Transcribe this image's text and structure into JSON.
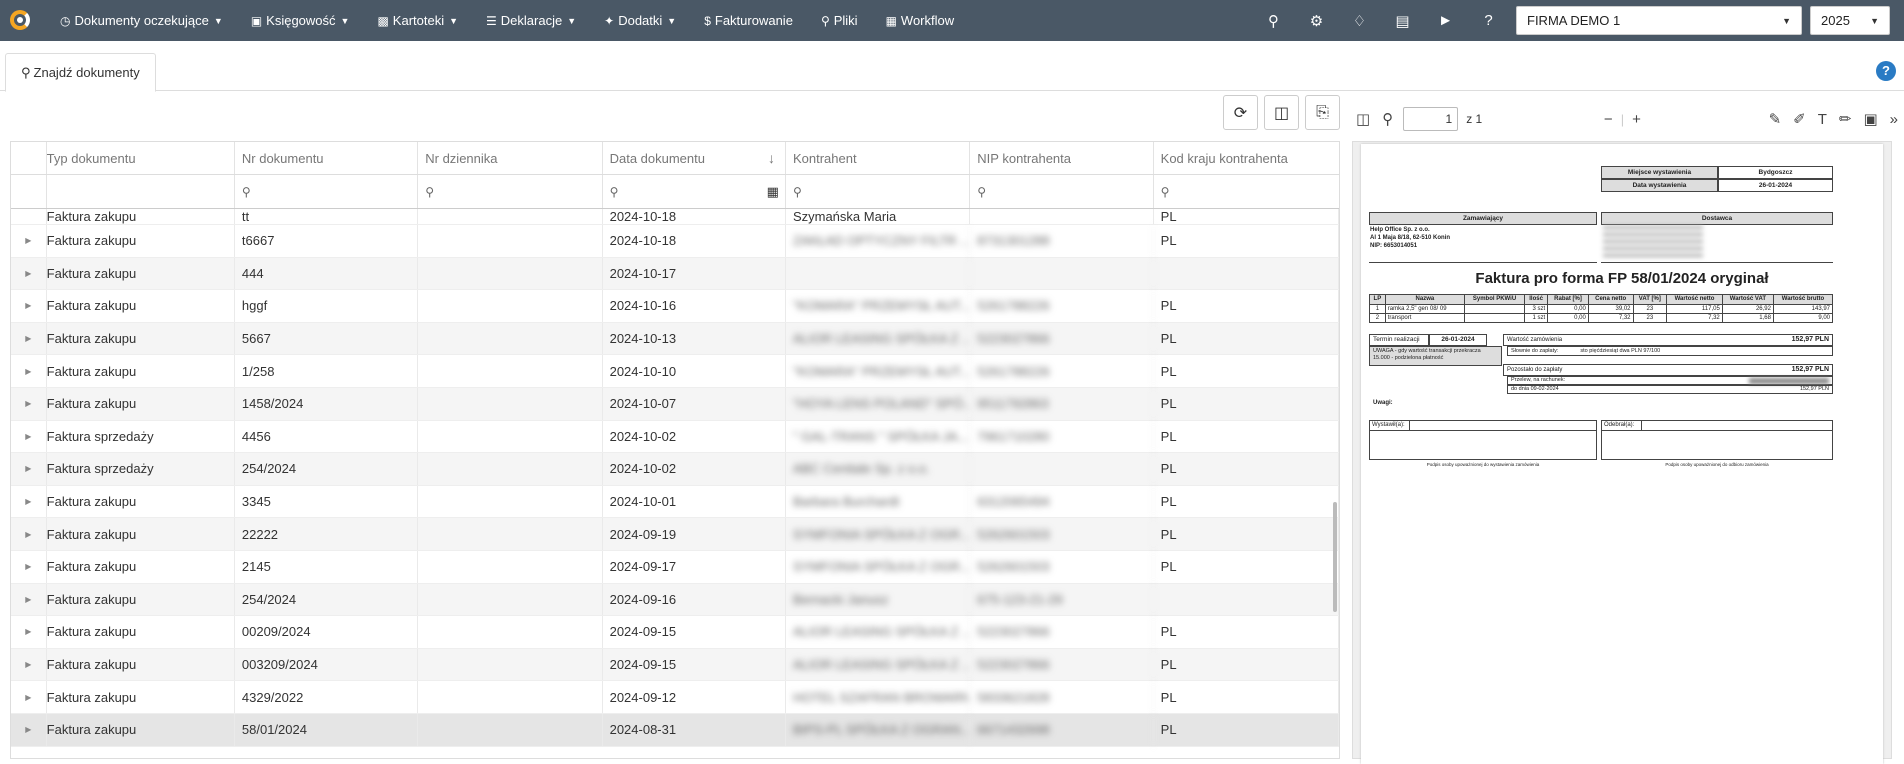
{
  "nav": {
    "items": [
      {
        "label": "Dokumenty oczekujące",
        "icon": "clock-icon",
        "caret": true
      },
      {
        "label": "Księgowość",
        "icon": "book-icon",
        "caret": true
      },
      {
        "label": "Kartoteki",
        "icon": "briefcase-icon",
        "caret": true
      },
      {
        "label": "Deklaracje",
        "icon": "list-icon",
        "caret": true
      },
      {
        "label": "Dodatki",
        "icon": "magic-icon",
        "caret": true
      },
      {
        "label": "Fakturowanie",
        "icon": "dollar-icon",
        "caret": false
      },
      {
        "label": "Pliki",
        "icon": "search-icon",
        "caret": false
      },
      {
        "label": "Workflow",
        "icon": "sitemap-icon",
        "caret": false
      }
    ],
    "company": "FIRMA DEMO 1",
    "year": "2025"
  },
  "tab": {
    "label": "Znajdź dokumenty"
  },
  "grid": {
    "columns": [
      "Typ dokumentu",
      "Nr dokumentu",
      "Nr dziennika",
      "Data dokumentu",
      "Kontrahent",
      "NIP kontrahenta",
      "Kod kraju kontrahenta"
    ],
    "top_partial": {
      "type": "Faktura zakupu",
      "number": "tt",
      "date": "2024-10-18",
      "contractor": "Szymańska Maria",
      "nip": "",
      "country": "PL"
    },
    "rows": [
      {
        "type": "Faktura zakupu",
        "number": "t6667",
        "journal": "",
        "date": "2024-10-18",
        "contractor": "ZAKŁAD OPTYCZNY FILTR ...",
        "nip": "8731301288",
        "country": "PL"
      },
      {
        "type": "Faktura zakupu",
        "number": "444",
        "journal": "",
        "date": "2024-10-17",
        "contractor": "",
        "nip": "",
        "country": ""
      },
      {
        "type": "Faktura zakupu",
        "number": "hggf",
        "journal": "",
        "date": "2024-10-16",
        "contractor": "\"KOMARA\" PRZEMYSŁ AUT...",
        "nip": "5261788226",
        "country": "PL"
      },
      {
        "type": "Faktura zakupu",
        "number": "5667",
        "journal": "",
        "date": "2024-10-13",
        "contractor": "ALIOR LEASING SPÓŁKA Z ...",
        "nip": "5223027866",
        "country": "PL"
      },
      {
        "type": "Faktura zakupu",
        "number": "1/258",
        "journal": "",
        "date": "2024-10-10",
        "contractor": "\"KOMARA\" PRZEMYSŁ AUT...",
        "nip": "5261788226",
        "country": "PL"
      },
      {
        "type": "Faktura zakupu",
        "number": "1458/2024",
        "journal": "",
        "date": "2024-10-07",
        "contractor": "\"HOYA LENS POLAND\" SPÓ...",
        "nip": "9511792863",
        "country": "PL"
      },
      {
        "type": "Faktura sprzedaży",
        "number": "4456",
        "journal": "",
        "date": "2024-10-02",
        "contractor": "\" GAL-TRANS \" SPÓŁKA JA...",
        "nip": "7961710280",
        "country": "PL"
      },
      {
        "type": "Faktura sprzedaży",
        "number": "254/2024",
        "journal": "",
        "date": "2024-10-02",
        "contractor": "ABC Cenitale Sp. z o.o.",
        "nip": "",
        "country": "PL"
      },
      {
        "type": "Faktura zakupu",
        "number": "3345",
        "journal": "",
        "date": "2024-10-01",
        "contractor": "Barbara Burchardt",
        "nip": "6312065494",
        "country": "PL"
      },
      {
        "type": "Faktura zakupu",
        "number": "22222",
        "journal": "",
        "date": "2024-09-19",
        "contractor": "SYMFONIA SPÓŁKA Z OGR...",
        "nip": "5262601503",
        "country": "PL"
      },
      {
        "type": "Faktura zakupu",
        "number": "2145",
        "journal": "",
        "date": "2024-09-17",
        "contractor": "SYMFONIA SPÓŁKA Z OGR...",
        "nip": "5262601503",
        "country": "PL"
      },
      {
        "type": "Faktura zakupu",
        "number": "254/2024",
        "journal": "",
        "date": "2024-09-16",
        "contractor": "Bernacki Janusz",
        "nip": "675-123-21-29",
        "country": ""
      },
      {
        "type": "Faktura zakupu",
        "number": "00209/2024",
        "journal": "",
        "date": "2024-09-15",
        "contractor": "ALIOR LEASING SPÓŁKA Z ...",
        "nip": "5223027866",
        "country": "PL"
      },
      {
        "type": "Faktura zakupu",
        "number": "003209/2024",
        "journal": "",
        "date": "2024-09-15",
        "contractor": "ALIOR LEASING SPÓŁKA Z ...",
        "nip": "5223027866",
        "country": "PL"
      },
      {
        "type": "Faktura zakupu",
        "number": "4329/2022",
        "journal": "",
        "date": "2024-09-12",
        "contractor": "HOTEL SZAFRAN BROWARN...",
        "nip": "5833621828",
        "country": "PL"
      },
      {
        "type": "Faktura zakupu",
        "number": "58/01/2024",
        "journal": "",
        "date": "2024-08-31",
        "contractor": "BIPS-PL SPÓŁKA Z OGRAN...",
        "nip": "6671432698",
        "country": "PL"
      }
    ]
  },
  "viewer": {
    "page": "1",
    "of_label": "z 1"
  },
  "pdf": {
    "place_label": "Miejsce wystawienia",
    "place_value": "Bydgoszcz",
    "date_label": "Data wystawienia",
    "date_value": "26-01-2024",
    "ordering_label": "Zamawiający",
    "supplier_label": "Dostawca",
    "ordering_name": "Help Office Sp. z o.o.",
    "ordering_addr": "Al 1 Maja 8/18, 62-510 Konin",
    "ordering_nip": "NIP: 6653014051",
    "title": "Faktura pro forma FP 58/01/2024 oryginał",
    "table_headers": [
      "LP",
      "Nazwa",
      "Symbol PKWiU",
      "Ilość",
      "Rabat [%]",
      "Cena netto",
      "VAT [%]",
      "Wartość netto",
      "Wartość VAT",
      "Wartość brutto"
    ],
    "table_rows": [
      [
        "1",
        "ramka 2,5\" gen 08/ 09",
        "",
        "3 szt",
        "0,00",
        "39,02",
        "23",
        "117,05",
        "26,92",
        "143,97"
      ],
      [
        "2",
        "transport",
        "",
        "1 szt",
        "0,00",
        "7,32",
        "23",
        "7,32",
        "1,68",
        "9,00"
      ]
    ],
    "term_label": "Termin realizacji",
    "term_value": "26-01-2024",
    "order_value_label": "Wartość zamówienia",
    "order_value": "152,97 PLN",
    "words_label": "Słownie do zapłaty:",
    "words_value": "sto pięćdziesiąt dwa PLN 97/100",
    "warning": "UWAGA - gdy wartość transakcji przekracza 15.000 - podzielona płatność",
    "remaining_label": "Pozostało do zapłaty",
    "remaining_value": "152,97 PLN",
    "transfer_label": "Przelew, na rachunek:",
    "due_label": "do dnia 09-02-2024",
    "due_value": "152,97 PLN",
    "remarks_label": "Uwagi:",
    "issued_label": "Wystawił(a):",
    "received_label": "Odebrał(a):",
    "sign_issue": "Podpis osoby upoważnionej do wystawienia zamówienia",
    "sign_receive": "Podpis osoby upoważnionej do odbioru zamówienia"
  },
  "colors": {
    "topbar": "#4a5866",
    "accent": "#2a7bc4",
    "logo": "#f5a623"
  }
}
